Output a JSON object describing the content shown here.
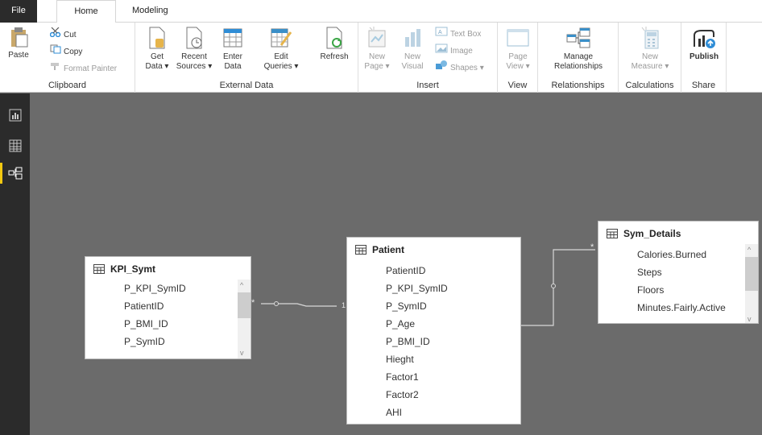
{
  "tabs": {
    "file": "File",
    "home": "Home",
    "modeling": "Modeling"
  },
  "ribbon": {
    "clipboard": {
      "paste": "Paste",
      "cut": "Cut",
      "copy": "Copy",
      "format_painter": "Format Painter",
      "label": "Clipboard"
    },
    "external_data": {
      "get_data_1": "Get",
      "get_data_2": "Data ▾",
      "recent_1": "Recent",
      "recent_2": "Sources ▾",
      "enter_1": "Enter",
      "enter_2": "Data",
      "edit_1": "Edit",
      "edit_2": "Queries ▾",
      "refresh": "Refresh",
      "label": "External Data"
    },
    "insert": {
      "new_page_1": "New",
      "new_page_2": "Page ▾",
      "new_visual_1": "New",
      "new_visual_2": "Visual",
      "text_box": "Text Box",
      "image": "Image",
      "shapes": "Shapes ▾",
      "label": "Insert"
    },
    "view": {
      "page_view_1": "Page",
      "page_view_2": "View ▾",
      "label": "View"
    },
    "relationships": {
      "manage_1": "Manage",
      "manage_2": "Relationships",
      "label": "Relationships"
    },
    "calculations": {
      "new_measure_1": "New",
      "new_measure_2": "Measure ▾",
      "label": "Calculations"
    },
    "share": {
      "publish": "Publish",
      "label": "Share"
    }
  },
  "tables": {
    "kpi": {
      "title": "KPI_Symt",
      "fields": [
        "P_KPI_SymID",
        "PatientID",
        "P_BMI_ID",
        "P_SymID"
      ]
    },
    "patient": {
      "title": "Patient",
      "fields": [
        "PatientID",
        "P_KPI_SymID",
        "P_SymID",
        "P_Age",
        "P_BMI_ID",
        "Hieght",
        "Factor1",
        "Factor2",
        "AHI"
      ]
    },
    "sym": {
      "title": "Sym_Details",
      "fields": [
        "Calories.Burned",
        "Steps",
        "Floors",
        "Minutes.Fairly.Active"
      ]
    }
  },
  "relationships": [
    {
      "from": "KPI_Symt",
      "to": "Patient",
      "from_card": "*",
      "to_card": "1"
    },
    {
      "from": "Patient",
      "to": "Sym_Details",
      "from_card": "1",
      "to_card": "*"
    }
  ],
  "colors": {
    "accent": "#f2c811",
    "canvas": "#6b6b6b",
    "nav": "#2b2b2b",
    "icon_blue": "#2f8dd6",
    "icon_green": "#3aa545"
  }
}
